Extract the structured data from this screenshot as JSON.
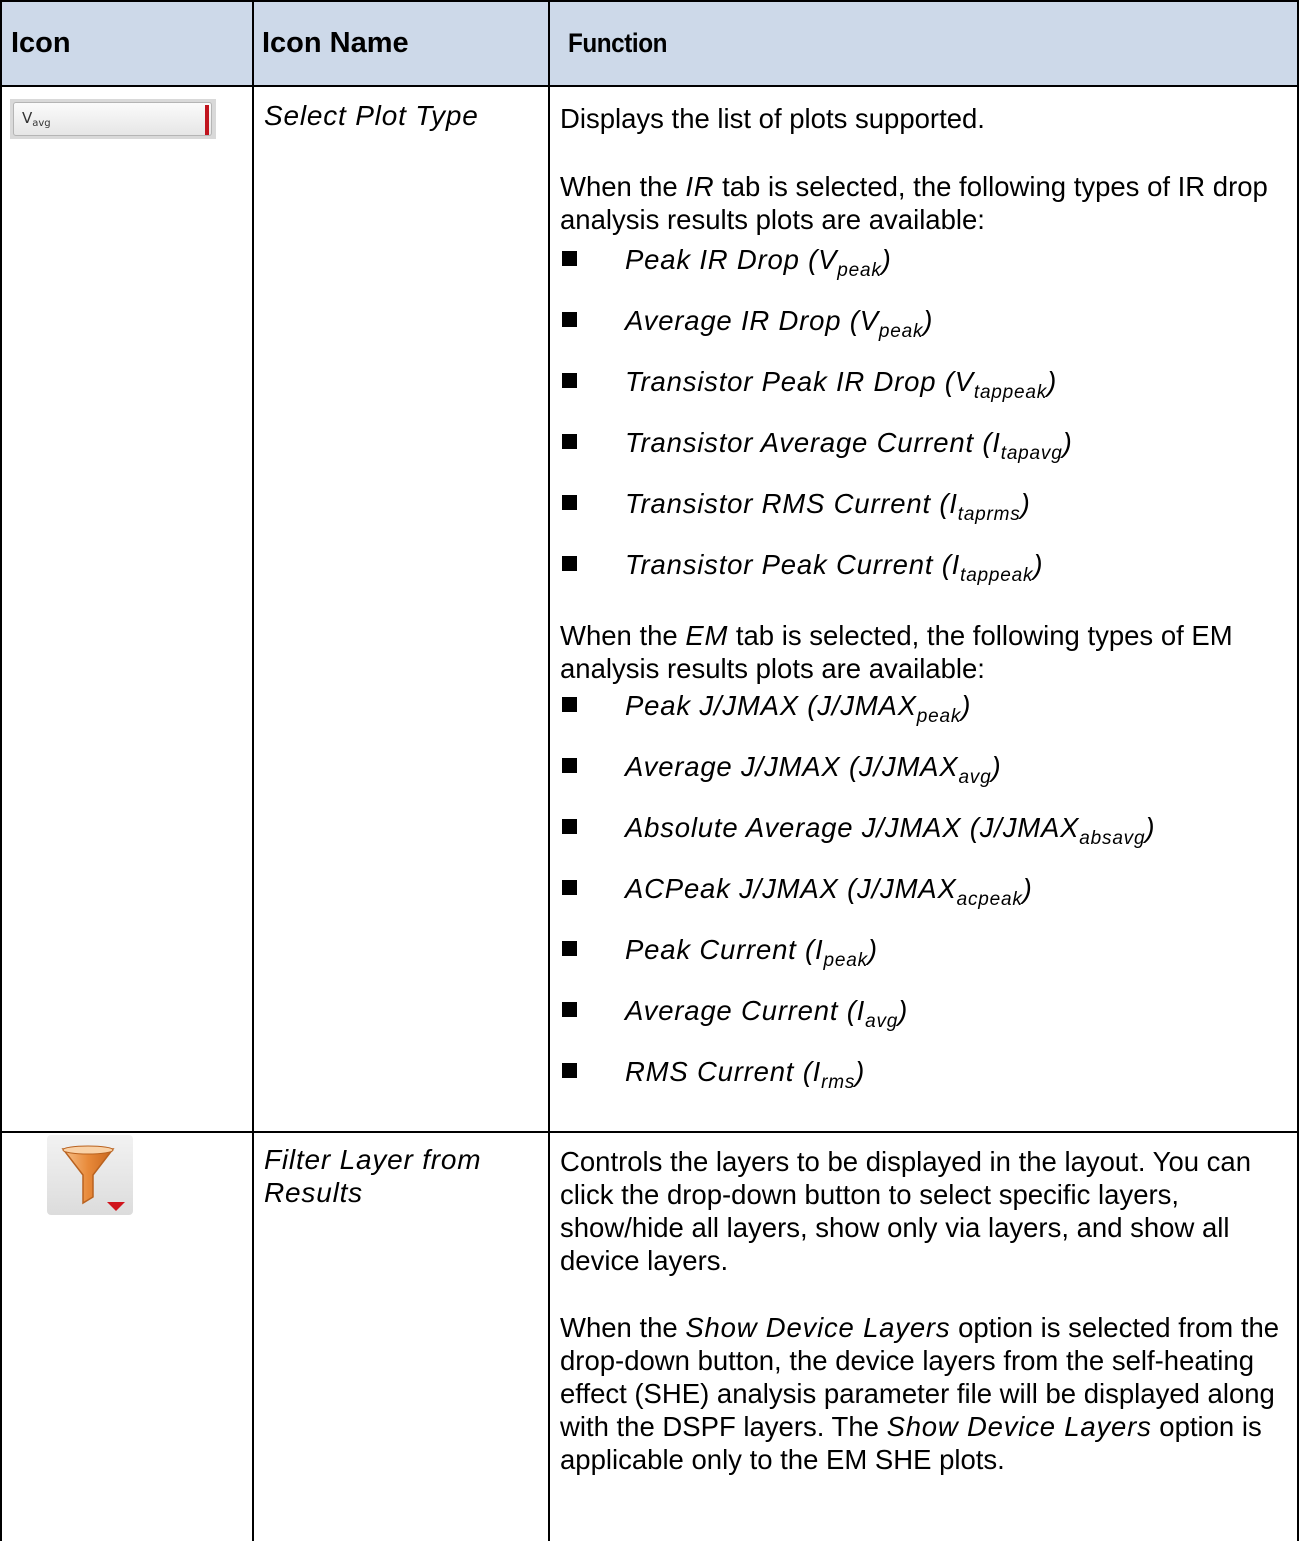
{
  "header": {
    "col_icon": "Icon",
    "col_name": "Icon Name",
    "col_function": "Function"
  },
  "rows": [
    {
      "icon": {
        "name": "vavg-dropdown-icon",
        "label": "V",
        "label_sub": "avg",
        "accent": "#c0141e"
      },
      "name": "Select Plot Type",
      "para1": "Displays the list of plots supported.",
      "ir_intro": {
        "pre": "When the ",
        "em": "IR",
        "post": " tab is selected, the following types of IR drop analysis results plots are available:"
      },
      "ir_items": [
        {
          "text": "Peak IR Drop (V",
          "sub": "peak",
          "close": ")"
        },
        {
          "text": "Average IR Drop (V",
          "sub": "peak",
          "close": ")"
        },
        {
          "text": "Transistor Peak IR Drop (V",
          "sub": "tappeak",
          "close": ")"
        },
        {
          "text": "Transistor Average Current (I",
          "sub": "tapavg",
          "close": ")"
        },
        {
          "text": "Transistor RMS Current (I",
          "sub": "taprms",
          "close": ")"
        },
        {
          "text": "Transistor Peak Current (I",
          "sub": "tappeak",
          "close": ")"
        }
      ],
      "em_intro": {
        "pre": "When the ",
        "em": "EM",
        "post": " tab is selected, the following types of EM analysis results plots are available:"
      },
      "em_items": [
        {
          "text": "Peak J/JMAX (J/JMAX",
          "sub": "peak",
          "close": ")"
        },
        {
          "text": "Average J/JMAX (J/JMAX",
          "sub": "avg",
          "close": ")"
        },
        {
          "text": "Absolute Average J/JMAX (J/JMAX",
          "sub": "absavg",
          "close": ")"
        },
        {
          "text": "ACPeak J/JMAX (J/JMAX",
          "sub": "acpeak",
          "close": ")"
        },
        {
          "text": "Peak Current (I",
          "sub": "peak",
          "close": ")"
        },
        {
          "text": "Average Current (I",
          "sub": "avg",
          "close": ")"
        },
        {
          "text": "RMS Current (I",
          "sub": "rms",
          "close": ")"
        }
      ]
    },
    {
      "icon": {
        "name": "filter-funnel-icon",
        "color": "#e88a3a",
        "arrow_color": "#d0141c"
      },
      "name_line1": "Filter Layer from",
      "name_line2": "Results",
      "para1": "Controls the layers to be displayed in the layout. You can click the drop-down button to select specific layers, show/hide all layers, show only via layers, and show all device layers.",
      "para2": {
        "pre": "When the ",
        "em1": "Show Device Layers",
        "mid": " option is selected from the drop-down button, the device layers from the self-heating effect (SHE) analysis parameter file will be displayed along with the DSPF layers. The ",
        "em2": "Show Device Layers",
        "post": " option is applicable only to the EM SHE plots."
      }
    }
  ],
  "colors": {
    "header_bg": "#cdd9e9",
    "grid": "#000000"
  }
}
